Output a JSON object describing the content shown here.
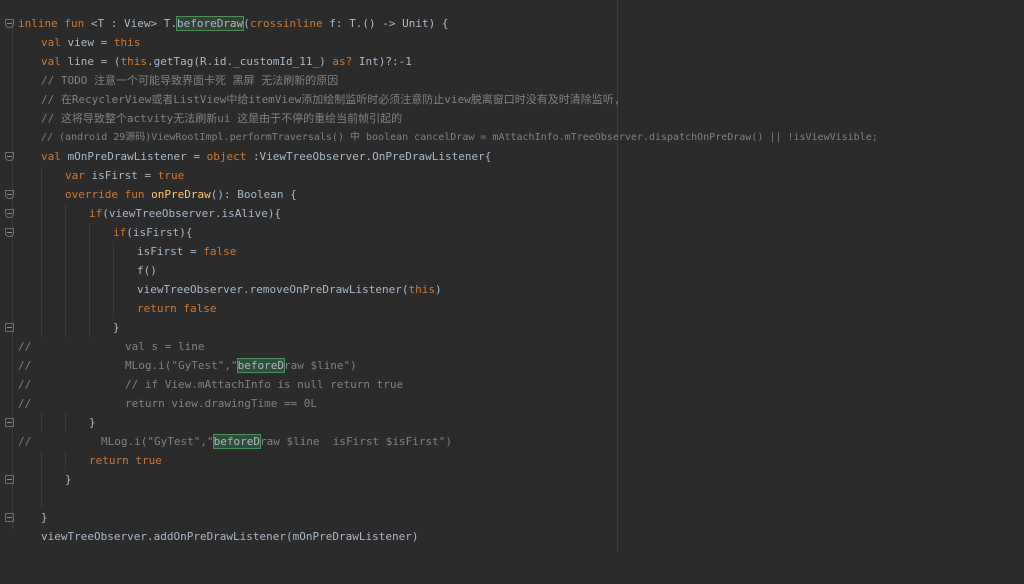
{
  "editor": {
    "lines": [
      {
        "t1": "inline fun ",
        "t2": "<T : View> T.",
        "t3": "beforeDraw",
        "t4": "(",
        "t5": "crossinline ",
        "t6": "f: T.() -> Unit) {"
      },
      {
        "t1": "val ",
        "t2": "view = ",
        "t3": "this"
      },
      {
        "t1": "val ",
        "t2": "line = (",
        "t3": "this",
        "t4": ".getTag(R.id._customId_11_) ",
        "t5": "as?",
        "t6": " Int)?:-1"
      },
      {
        "t1": "// TODO 注意一个可能导致界面卡死 黑屏 无法刷新的原因"
      },
      {
        "t1": "// 在RecyclerView或者ListView中给itemView添加绘制监听时必须注意防止view脱离窗口时没有及时清除监听,"
      },
      {
        "t1": "// 这将导致整个actvity无法刷新ui 这是由于不停的重绘当前帧引起的"
      },
      {
        "t1": "// (android 29源码)ViewRootImpl.performTraversals() 中 boolean cancelDraw = mAttachInfo.mTreeObserver.dispatchOnPreDraw() || !isViewVisible;"
      },
      {
        "t1": "val ",
        "t2": "mOnPreDrawListener = ",
        "t3": "object ",
        "t4": ":ViewTreeObserver.OnPreDrawListener{"
      },
      {
        "t1": "var ",
        "t2": "isFirst = ",
        "t3": "true"
      },
      {
        "t1": "override fun ",
        "t2": "onPreDraw",
        "t3": "(): Boolean {"
      },
      {
        "t1": "if",
        "t2": "(viewTreeObserver.isAlive){"
      },
      {
        "t1": "if",
        "t2": "(isFirst){"
      },
      {
        "t1": "isFirst = ",
        "t2": "false"
      },
      {
        "t1": "f()"
      },
      {
        "t1": "viewTreeObserver.removeOnPreDrawListener(",
        "t2": "this",
        ")": ")"
      },
      {
        "t1": "return false"
      },
      {
        "t1": "}"
      },
      {
        "t1": "//",
        "t2": "val s = line"
      },
      {
        "t1": "//",
        "t2": "MLog.i(\"GyTest\",\"",
        "t3": "beforeD",
        "t4": "raw $line\")"
      },
      {
        "t1": "//",
        "t2": "// if View.mAttachInfo is null return true"
      },
      {
        "t1": "//",
        "t2": "return view.drawingTime == 0L"
      },
      {
        "t1": "}"
      },
      {
        "t1": "//",
        "t2": "MLog.i(\"GyTest\",\"",
        "t3": "beforeD",
        "t4": "raw $line  isFirst $isFirst\")"
      },
      {
        "t1": "return true"
      },
      {
        "t1": "}"
      },
      {
        "t1": ""
      },
      {
        "t1": "}"
      },
      {
        "t1": "viewTreeObserver.addOnPreDrawListener(mOnPreDrawListener)"
      }
    ],
    "closing_paren": ")"
  },
  "colors": {
    "background": "#2b2b2b",
    "keyword": "#cc7832",
    "function": "#ffc66d",
    "comment": "#808080",
    "string": "#6a8759",
    "number": "#6897bb",
    "text": "#a9b7c6"
  }
}
